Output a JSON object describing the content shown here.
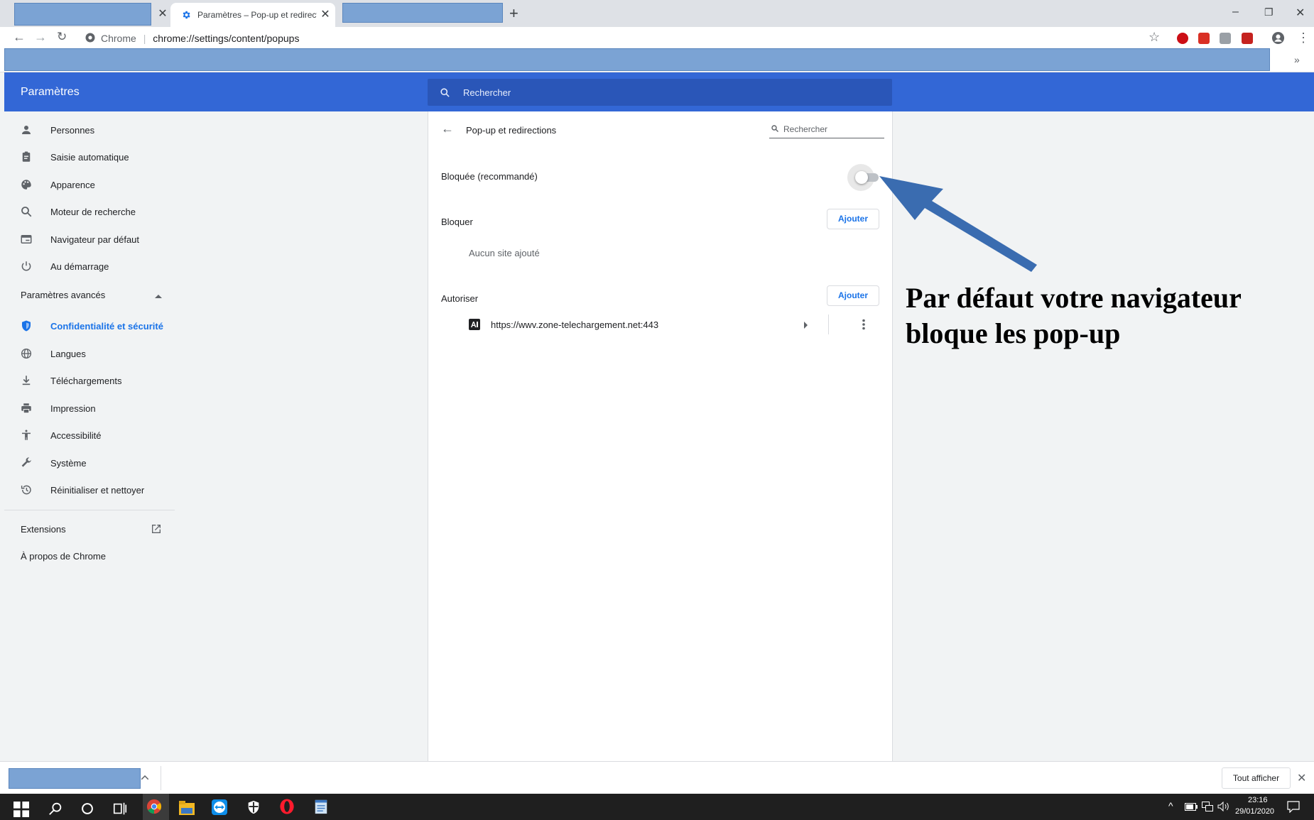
{
  "browser": {
    "tab_title": "Paramètres – Pop-up et redirections",
    "omnibox_label": "Chrome",
    "omnibox_url": "chrome://settings/content/popups",
    "window_controls": [
      "minimize-icon",
      "restore-icon",
      "close-icon"
    ]
  },
  "header": {
    "title": "Paramètres",
    "search_placeholder": "Rechercher"
  },
  "sidebar": {
    "items": [
      {
        "label": "Personnes",
        "icon": "person-icon"
      },
      {
        "label": "Saisie automatique",
        "icon": "clipboard-icon"
      },
      {
        "label": "Apparence",
        "icon": "palette-icon"
      },
      {
        "label": "Moteur de recherche",
        "icon": "search-icon"
      },
      {
        "label": "Navigateur par défaut",
        "icon": "browser-icon"
      },
      {
        "label": "Au démarrage",
        "icon": "power-icon"
      }
    ],
    "advanced_label": "Paramètres avancés",
    "advanced_items": [
      {
        "label": "Confidentialité et sécurité",
        "icon": "shield-icon"
      },
      {
        "label": "Langues",
        "icon": "globe-icon"
      },
      {
        "label": "Téléchargements",
        "icon": "download-icon"
      },
      {
        "label": "Impression",
        "icon": "printer-icon"
      },
      {
        "label": "Accessibilité",
        "icon": "accessibility-icon"
      },
      {
        "label": "Système",
        "icon": "wrench-icon"
      },
      {
        "label": "Réinitialiser et nettoyer",
        "icon": "history-icon"
      }
    ],
    "extensions_label": "Extensions",
    "about_label": "À propos de Chrome"
  },
  "main": {
    "page_title": "Pop-up et redirections",
    "search_placeholder": "Rechercher",
    "toggle_label": "Bloquée (recommandé)",
    "toggle_on": false,
    "block_section": "Bloquer",
    "block_add_label": "Ajouter",
    "block_empty": "Aucun site ajouté",
    "allow_section": "Autoriser",
    "allow_add_label": "Ajouter",
    "allow_sites": [
      "https://wwv.zone-telechargement.net:443"
    ]
  },
  "annotation": {
    "text": "Par défaut votre navigateur bloque les pop-up",
    "arrow_color": "#3a6cb0"
  },
  "downloads_bar": {
    "show_all_label": "Tout afficher"
  },
  "taskbar": {
    "time": "23:16",
    "date": "29/01/2020"
  },
  "colors": {
    "accent": "#1a73e8",
    "header": "#3367d6"
  }
}
